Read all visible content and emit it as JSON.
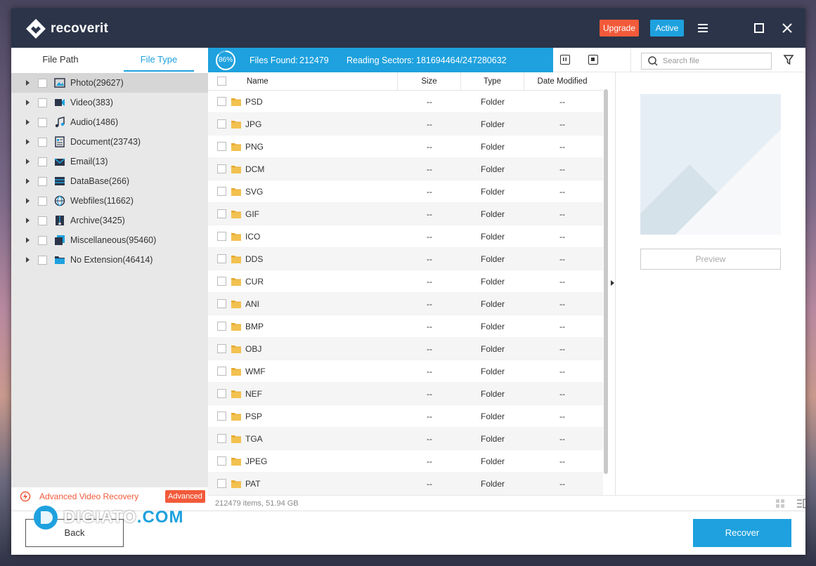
{
  "app": {
    "name": "recoverit"
  },
  "header": {
    "upgrade_label": "Upgrade",
    "active_label": "Active"
  },
  "tabs": [
    {
      "label": "File Path"
    },
    {
      "label": "File Type"
    }
  ],
  "tree": [
    {
      "label": "Photo(29627)",
      "icon": "image-icon"
    },
    {
      "label": "Video(383)",
      "icon": "video-icon"
    },
    {
      "label": "Audio(1486)",
      "icon": "music-icon"
    },
    {
      "label": "Document(23743)",
      "icon": "document-icon"
    },
    {
      "label": "Email(13)",
      "icon": "email-icon"
    },
    {
      "label": "DataBase(266)",
      "icon": "database-icon"
    },
    {
      "label": "Webfiles(11662)",
      "icon": "globe-icon"
    },
    {
      "label": "Archive(3425)",
      "icon": "archive-icon"
    },
    {
      "label": "Miscellaneous(95460)",
      "icon": "misc-icon"
    },
    {
      "label": "No Extension(46414)",
      "icon": "folder-icon"
    }
  ],
  "advanced": {
    "label": "Advanced Video Recovery",
    "badge": "Advanced"
  },
  "status": {
    "progress": "86%",
    "files_found_label": "Files Found:",
    "files_found_value": "212479",
    "reading_label": "Reading Sectors:",
    "reading_value": "181694464/247280632"
  },
  "search": {
    "placeholder": "Search file"
  },
  "columns": {
    "name": "Name",
    "size": "Size",
    "type": "Type",
    "date": "Date Modified"
  },
  "rows": [
    {
      "name": "PSD",
      "size": "--",
      "type": "Folder",
      "date": "--"
    },
    {
      "name": "JPG",
      "size": "--",
      "type": "Folder",
      "date": "--"
    },
    {
      "name": "PNG",
      "size": "--",
      "type": "Folder",
      "date": "--"
    },
    {
      "name": "DCM",
      "size": "--",
      "type": "Folder",
      "date": "--"
    },
    {
      "name": "SVG",
      "size": "--",
      "type": "Folder",
      "date": "--"
    },
    {
      "name": "GIF",
      "size": "--",
      "type": "Folder",
      "date": "--"
    },
    {
      "name": "ICO",
      "size": "--",
      "type": "Folder",
      "date": "--"
    },
    {
      "name": "DDS",
      "size": "--",
      "type": "Folder",
      "date": "--"
    },
    {
      "name": "CUR",
      "size": "--",
      "type": "Folder",
      "date": "--"
    },
    {
      "name": "ANI",
      "size": "--",
      "type": "Folder",
      "date": "--"
    },
    {
      "name": "BMP",
      "size": "--",
      "type": "Folder",
      "date": "--"
    },
    {
      "name": "OBJ",
      "size": "--",
      "type": "Folder",
      "date": "--"
    },
    {
      "name": "WMF",
      "size": "--",
      "type": "Folder",
      "date": "--"
    },
    {
      "name": "NEF",
      "size": "--",
      "type": "Folder",
      "date": "--"
    },
    {
      "name": "PSP",
      "size": "--",
      "type": "Folder",
      "date": "--"
    },
    {
      "name": "TGA",
      "size": "--",
      "type": "Folder",
      "date": "--"
    },
    {
      "name": "JPEG",
      "size": "--",
      "type": "Folder",
      "date": "--"
    },
    {
      "name": "PAT",
      "size": "--",
      "type": "Folder",
      "date": "--"
    }
  ],
  "preview": {
    "button_label": "Preview"
  },
  "footer": {
    "summary": "212479 items, 51.94  GB"
  },
  "actions": {
    "back_label": "Back",
    "recover_label": "Recover"
  },
  "watermark": {
    "text": "DIGIATO.COM"
  },
  "colors": {
    "accent": "#1ea1de",
    "warning": "#f25a3a",
    "titlebar": "#2b3448",
    "folder": "#f2c150"
  }
}
